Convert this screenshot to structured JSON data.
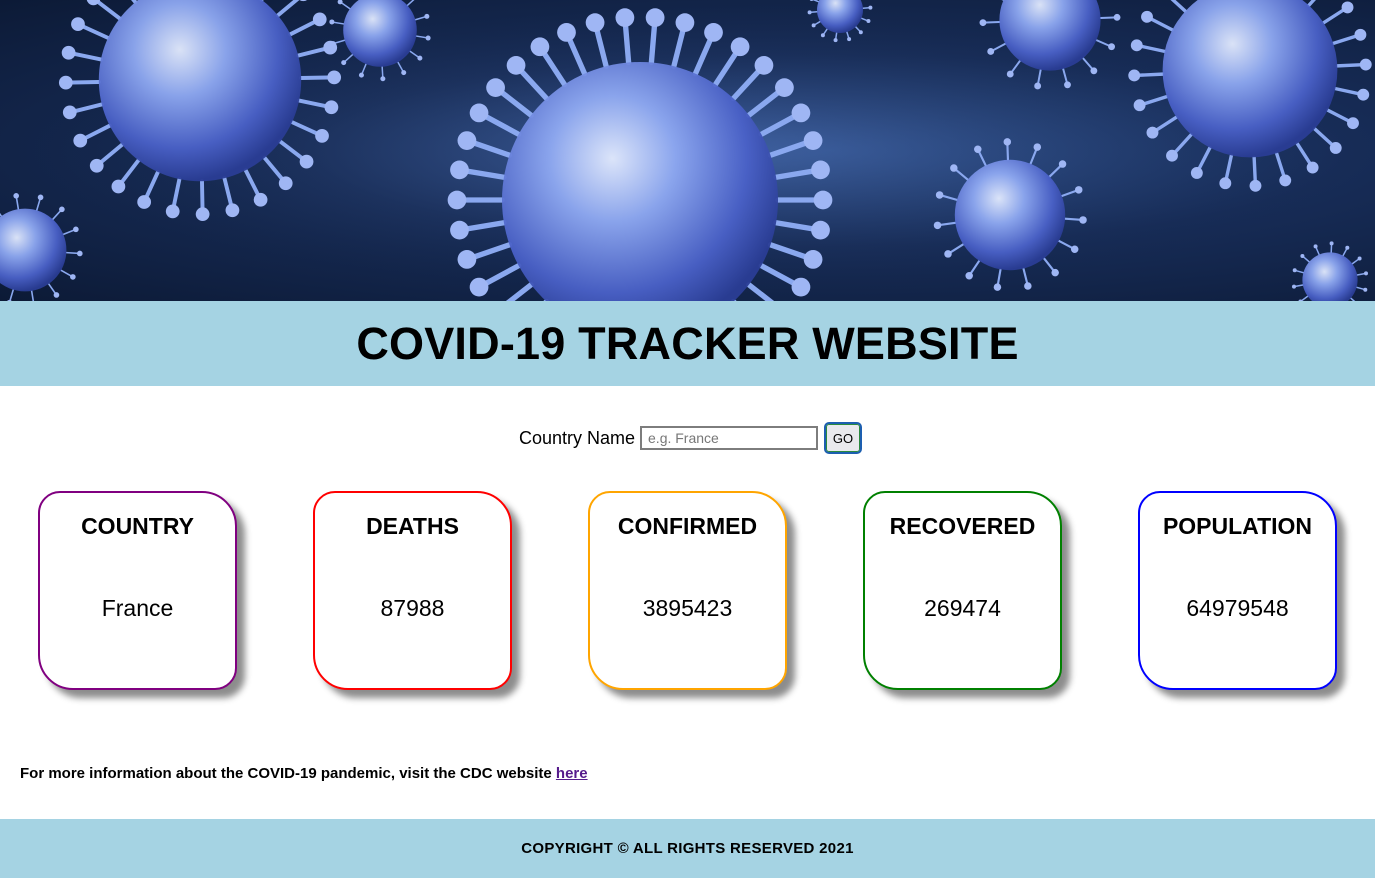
{
  "header": {
    "title": "COVID-19 TRACKER WEBSITE"
  },
  "search": {
    "label": "Country Name",
    "placeholder": "e.g. France",
    "value": "",
    "button_label": "GO"
  },
  "cards": [
    {
      "title": "COUNTRY",
      "value": "France",
      "color": "#800080"
    },
    {
      "title": "DEATHS",
      "value": "87988",
      "color": "#ff0000"
    },
    {
      "title": "CONFIRMED",
      "value": "3895423",
      "color": "#ffa500"
    },
    {
      "title": "RECOVERED",
      "value": "269474",
      "color": "#008000"
    },
    {
      "title": "POPULATION",
      "value": "64979548",
      "color": "#0000ff"
    }
  ],
  "info": {
    "text": "For more information about the COVID-19 pandemic, visit the CDC website ",
    "link_label": "here"
  },
  "footer": {
    "text": "COPYRIGHT © ALL RIGHTS RESERVED 2021"
  },
  "colors": {
    "band": "#a5d3e3",
    "hero_bg": "#172c57",
    "virus": "#6f8de6"
  }
}
